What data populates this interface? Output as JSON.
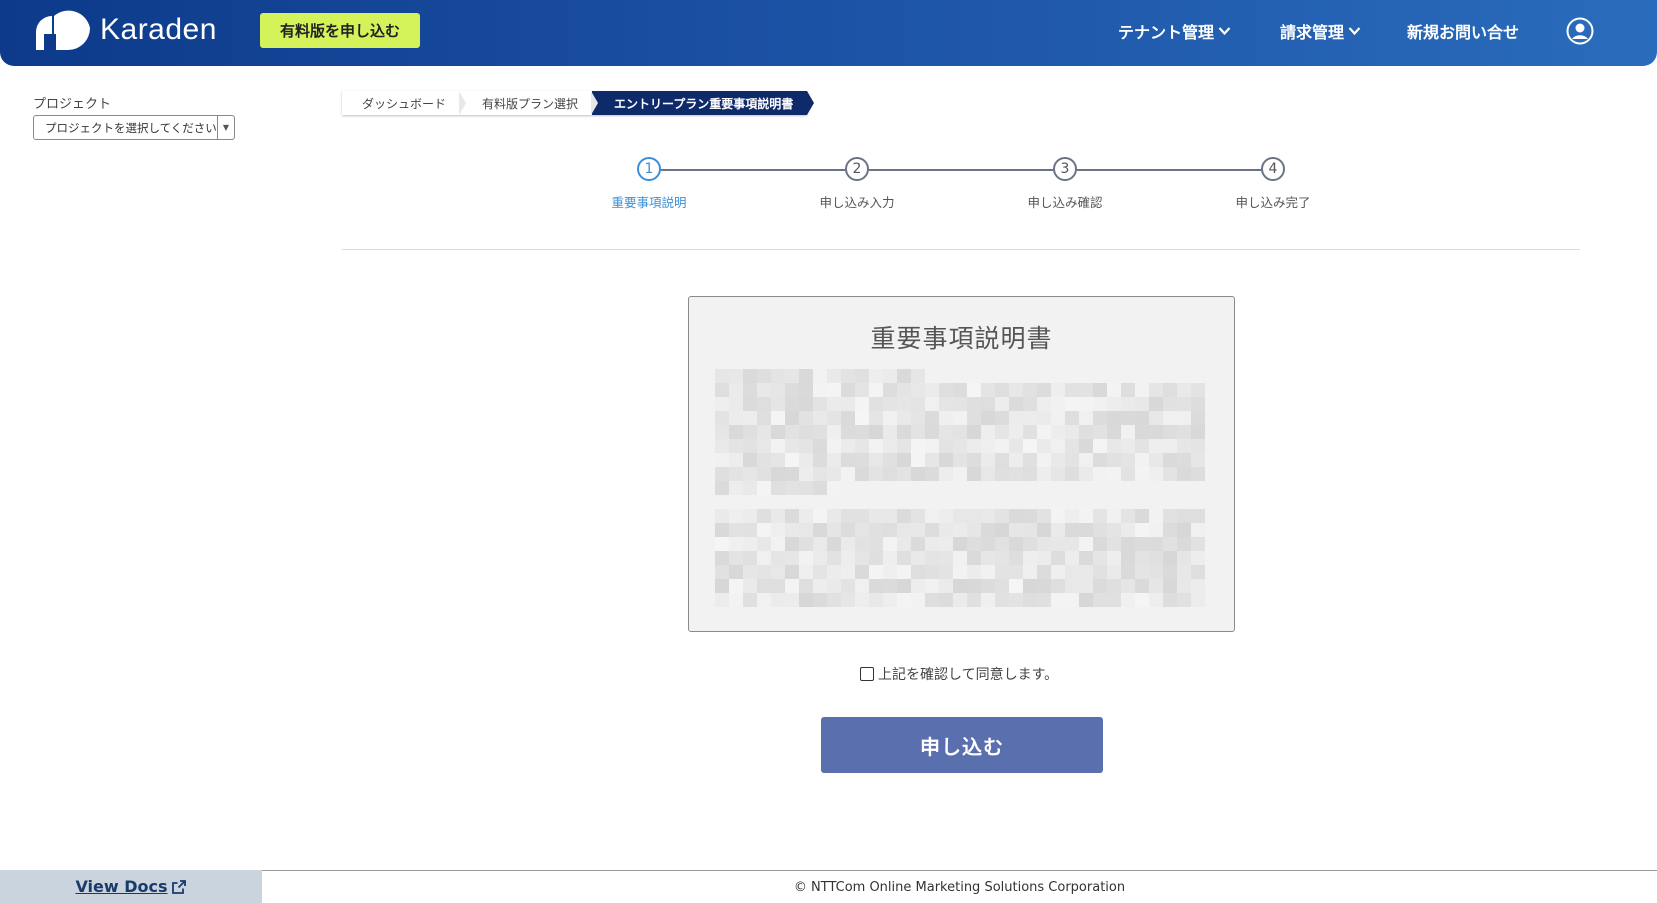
{
  "header": {
    "brand": "Karaden",
    "upgrade_button": "有料版を申し込む",
    "nav": [
      {
        "label": "テナント管理",
        "has_dropdown": true
      },
      {
        "label": "請求管理",
        "has_dropdown": true
      },
      {
        "label": "新規お問い合せ",
        "has_dropdown": false
      }
    ],
    "account_icon": "user-circle-icon"
  },
  "sidebar": {
    "project_label": "プロジェクト",
    "project_select_placeholder": "プロジェクトを選択してください"
  },
  "breadcrumb": [
    {
      "label": "ダッシュボード",
      "active": false
    },
    {
      "label": "有料版プラン選択",
      "active": false
    },
    {
      "label": "エントリープラン重要事項説明書",
      "active": true
    }
  ],
  "steps": [
    {
      "number": "1",
      "label": "重要事項説明",
      "current": true
    },
    {
      "number": "2",
      "label": "申し込み入力",
      "current": false
    },
    {
      "number": "3",
      "label": "申し込み確認",
      "current": false
    },
    {
      "number": "4",
      "label": "申し込み完了",
      "current": false
    }
  ],
  "document": {
    "title": "重要事項説明書"
  },
  "agreement": {
    "label": "上記を確認して同意します。",
    "checked": false
  },
  "submit_button": "申し込む",
  "footer": {
    "docs_link": "View Docs",
    "copyright": "© NTTCom Online Marketing Solutions Corporation"
  },
  "colors": {
    "header_start": "#0d3a8a",
    "header_end": "#2a6cbc",
    "upgrade_button": "#d4f35a",
    "active_step": "#3a8fd8",
    "submit_button": "#5a6fae",
    "breadcrumb_active": "#0f2a6b"
  }
}
